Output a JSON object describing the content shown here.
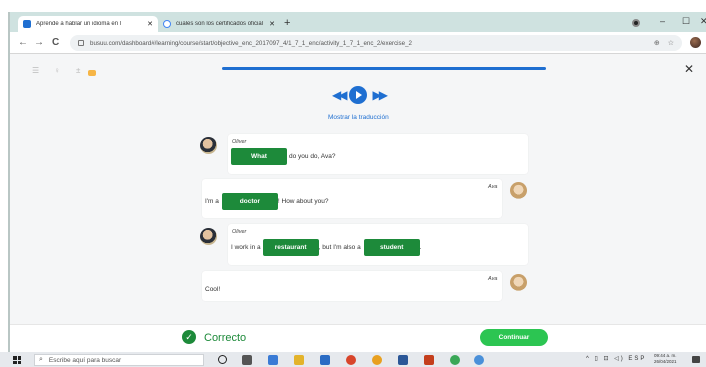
{
  "browser": {
    "tabs": [
      {
        "title": "Aprende a hablar un idioma en l",
        "favicon_color": "#1f6fd1"
      },
      {
        "title": "cuales son los certificados oficial",
        "favicon_color": "#4285f4"
      }
    ],
    "new_tab": "+",
    "url": "busuu.com/dashboard#/learning/course/start/objective_enc_2017097_4/1_7_1_enc/activity_1_7_1_enc_2/exercise_2",
    "nav": {
      "back": "←",
      "forward": "→",
      "reload": "C"
    },
    "window_controls": {
      "minimize": "–",
      "maximize": "☐",
      "close": "✕"
    }
  },
  "exercise": {
    "close_label": "✕",
    "show_translation": "Mostrar la traducción",
    "progress": 1.0,
    "dialogue": [
      {
        "speaker": "Oliver",
        "before": "",
        "answer": "What",
        "after": "do you do, Ava?"
      },
      {
        "speaker": "Ava",
        "before": "I'm a",
        "answer": "doctor",
        "after": "! How about you?"
      },
      {
        "speaker": "Oliver",
        "before": "I work in a",
        "answer": "restaurant",
        "after": ", but I'm also a",
        "answer2": "student",
        "after2": "."
      },
      {
        "speaker": "Ava",
        "before": "Cool!",
        "answer": "",
        "after": ""
      }
    ],
    "feedback": "Correcto",
    "continue_label": "Continuar"
  },
  "taskbar": {
    "search_placeholder": "Escribe aquí para buscar",
    "tray": "^ ▯ ⊡ ◁) ESP",
    "time": "09:44 a. m.",
    "date": "26/04/2021"
  },
  "colors": {
    "accent_blue": "#1f6fd1",
    "answer_green": "#1d8a3a",
    "continue_green": "#2cc552"
  }
}
